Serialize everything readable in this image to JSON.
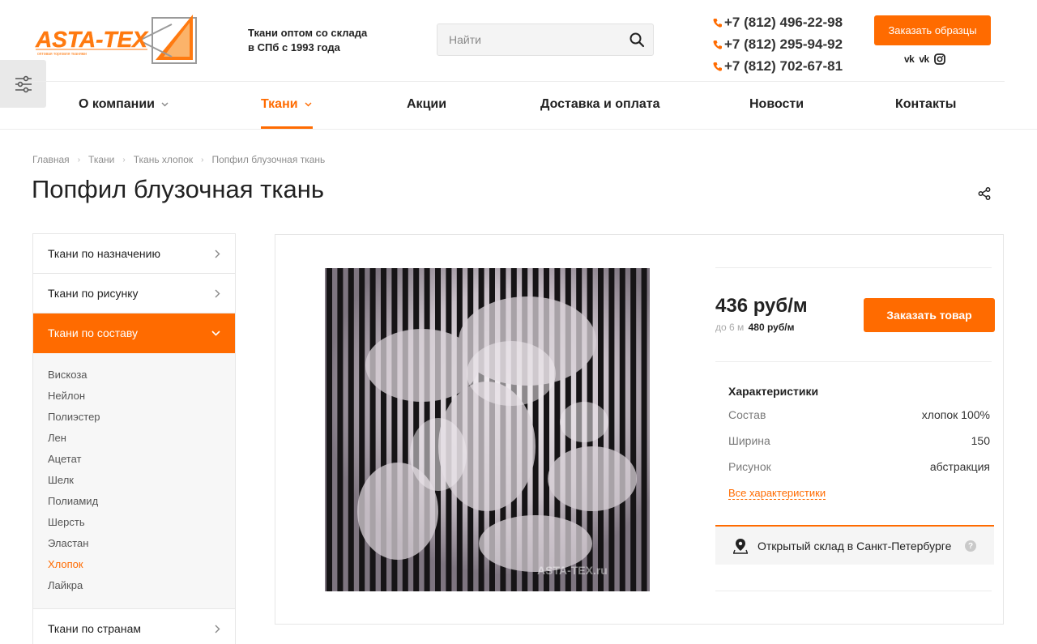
{
  "header": {
    "logo_text": "ASTA-TEX",
    "logo_caption": "оптовая торговля тканями",
    "tagline_line1": "Ткани оптом со склада",
    "tagline_line2": "в СПб с 1993 года",
    "search_placeholder": "Найти",
    "phones": [
      "+7 (812) 496-22-98",
      "+7 (812) 295-94-92",
      "+7 (812) 702-67-81"
    ],
    "samples_button": "Заказать образцы",
    "socials": [
      {
        "label": "vk",
        "icon": "vk-icon"
      },
      {
        "label": "vk",
        "icon": "vk-icon"
      },
      {
        "label": "",
        "icon": "instagram-icon"
      }
    ]
  },
  "nav": {
    "items": [
      {
        "label": "О компании",
        "dropdown": true,
        "active": false
      },
      {
        "label": "Ткани",
        "dropdown": true,
        "active": true
      },
      {
        "label": "Акции",
        "dropdown": false,
        "active": false
      },
      {
        "label": "Доставка и оплата",
        "dropdown": false,
        "active": false
      },
      {
        "label": "Новости",
        "dropdown": false,
        "active": false
      },
      {
        "label": "Контакты",
        "dropdown": false,
        "active": false
      }
    ]
  },
  "breadcrumb": [
    "Главная",
    "Ткани",
    "Ткань хлопок",
    "Попфил блузочная ткань"
  ],
  "page_title": "Попфил блузочная ткань",
  "sidebar": {
    "sections": [
      {
        "label": "Ткани по назначению",
        "expanded": false
      },
      {
        "label": "Ткани по рисунку",
        "expanded": false
      },
      {
        "label": "Ткани по составу",
        "expanded": true
      },
      {
        "label": "Ткани по странам",
        "expanded": false
      }
    ],
    "composition_items": [
      {
        "label": "Вискоза",
        "active": false
      },
      {
        "label": "Нейлон",
        "active": false
      },
      {
        "label": "Полиэстер",
        "active": false
      },
      {
        "label": "Лен",
        "active": false
      },
      {
        "label": "Ацетат",
        "active": false
      },
      {
        "label": "Шелк",
        "active": false
      },
      {
        "label": "Полиамид",
        "active": false
      },
      {
        "label": "Шерсть",
        "active": false
      },
      {
        "label": "Эластан",
        "active": false
      },
      {
        "label": "Хлопок",
        "active": true
      },
      {
        "label": "Лайкра",
        "active": false
      }
    ]
  },
  "product": {
    "watermark": "ASTA-TEX.ru",
    "price": "436 руб/м",
    "price_small_prefix": "до 6 м",
    "price_small_value": "480 руб/м",
    "order_button": "Заказать товар",
    "characteristics_title": "Характеристики",
    "characteristics": [
      {
        "name": "Состав",
        "value": "хлопок 100%"
      },
      {
        "name": "Ширина",
        "value": "150"
      },
      {
        "name": "Рисунок",
        "value": "абстракция"
      }
    ],
    "all_characteristics_link": "Все характеристики",
    "store_label": "Открытый склад в Санкт-Петербурге",
    "store_help": "?"
  },
  "colors": {
    "accent": "#ff6b00",
    "text": "#222222",
    "muted": "#8d8d8d"
  }
}
